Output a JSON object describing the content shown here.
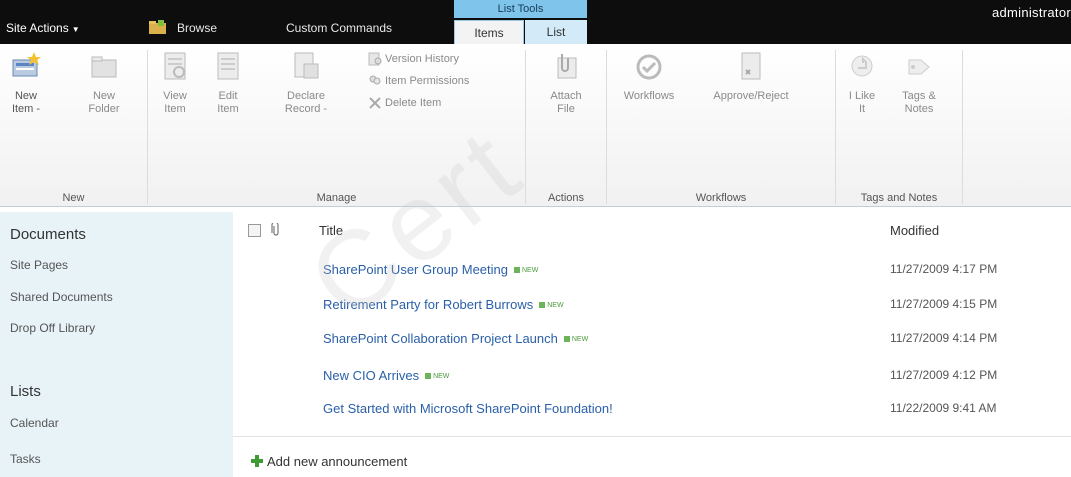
{
  "topbar": {
    "site_actions_label": "Site Actions",
    "tabs": {
      "browse": "Browse",
      "custom_commands": "Custom Commands",
      "items": "Items",
      "list": "List"
    },
    "contextual_group_label": "List Tools",
    "user_name": "administrator"
  },
  "ribbon": {
    "groups": {
      "new": {
        "label": "New",
        "buttons": {
          "new_item": "New\nItem -",
          "new_folder": "New\nFolder"
        }
      },
      "manage": {
        "label": "Manage",
        "buttons": {
          "view_item": "View\nItem",
          "edit_item": "Edit\nItem",
          "declare_record": "Declare\nRecord -",
          "version_history": "Version History",
          "item_permissions": "Item Permissions",
          "delete_item": "Delete Item"
        }
      },
      "actions": {
        "label": "Actions",
        "buttons": {
          "attach_file": "Attach\nFile"
        }
      },
      "workflows": {
        "label": "Workflows",
        "buttons": {
          "workflows": "Workflows",
          "approve_reject": "Approve/Reject"
        }
      },
      "tags_notes": {
        "label": "Tags and Notes",
        "buttons": {
          "i_like_it": "I Like\nIt",
          "tags_notes": "Tags &\nNotes"
        }
      }
    }
  },
  "leftnav": {
    "documents_heading": "Documents",
    "documents": [
      "Site Pages",
      "Shared Documents",
      "Drop Off Library"
    ],
    "lists_heading": "Lists",
    "lists": [
      "Calendar",
      "Tasks"
    ]
  },
  "list": {
    "columns": {
      "title": "Title",
      "modified": "Modified"
    },
    "new_badge": "NEW",
    "rows": [
      {
        "title": "SharePoint User Group Meeting",
        "is_new": true,
        "modified": "11/27/2009 4:17 PM"
      },
      {
        "title": "Retirement Party for Robert Burrows",
        "is_new": true,
        "modified": "11/27/2009 4:15 PM"
      },
      {
        "title": "SharePoint Collaboration Project Launch",
        "is_new": true,
        "modified": "11/27/2009 4:14 PM"
      },
      {
        "title": "New CIO Arrives",
        "is_new": true,
        "modified": "11/27/2009 4:12 PM"
      },
      {
        "title": "Get Started with Microsoft SharePoint Foundation!",
        "is_new": false,
        "modified": "11/22/2009 9:41 AM"
      }
    ],
    "add_new_label": "Add new announcement"
  },
  "watermark_text": "Cert"
}
